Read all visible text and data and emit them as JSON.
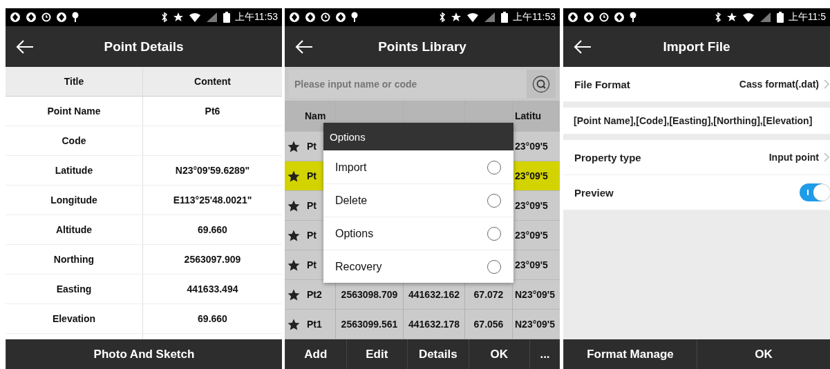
{
  "screens": [
    {
      "kind": "details",
      "status_bar": {
        "time": "上午11:53"
      },
      "title": "Point Details",
      "table": {
        "columns": [
          "Title",
          "Content"
        ],
        "rows": [
          [
            "Point Name",
            "Pt6"
          ],
          [
            "Code",
            ""
          ],
          [
            "Latitude",
            "N23°09'59.6289\""
          ],
          [
            "Longitude",
            "E113°25'48.0021\""
          ],
          [
            "Altitude",
            "69.660"
          ],
          [
            "Northing",
            "2563097.909"
          ],
          [
            "Easting",
            "441633.494"
          ],
          [
            "Elevation",
            "69.660"
          ]
        ]
      },
      "bottom_buttons": [
        "Photo And Sketch"
      ]
    },
    {
      "kind": "library",
      "status_bar": {
        "time": "上午11:53"
      },
      "title": "Points Library",
      "search": {
        "placeholder": "Please input name or code"
      },
      "table": {
        "columns": [
          "Nam",
          null,
          null,
          null,
          "Latitu"
        ],
        "rows": [
          {
            "selected": false,
            "cells": [
              "Pt",
              null,
              null,
              null,
              "23°09'5"
            ]
          },
          {
            "selected": true,
            "cells": [
              "Pt",
              null,
              null,
              null,
              "23°09'5"
            ]
          },
          {
            "selected": false,
            "cells": [
              "Pt",
              null,
              null,
              null,
              "23°09'5"
            ]
          },
          {
            "selected": false,
            "cells": [
              "Pt",
              null,
              null,
              null,
              "23°09'5"
            ]
          },
          {
            "selected": false,
            "cells": [
              "Pt",
              null,
              null,
              null,
              "23°09'5"
            ]
          },
          {
            "selected": false,
            "cells": [
              "Pt2",
              "2563098.709",
              "441632.162",
              "67.072",
              "N23°09'5"
            ]
          },
          {
            "selected": false,
            "cells": [
              "Pt1",
              "2563099.561",
              "441632.178",
              "67.056",
              "N23°09'5"
            ]
          }
        ]
      },
      "dialog": {
        "title": "Options",
        "items": [
          {
            "label": "Import",
            "selected": false
          },
          {
            "label": "Delete",
            "selected": false
          },
          {
            "label": "Options",
            "selected": false
          },
          {
            "label": "Recovery",
            "selected": false
          }
        ]
      },
      "bottom_buttons": [
        "Add",
        "Edit",
        "Details",
        "OK",
        "..."
      ]
    },
    {
      "kind": "import",
      "status_bar": {
        "time": "上午11:5"
      },
      "title": "Import File",
      "rows": [
        {
          "kind": "select",
          "label": "File Format",
          "value": "Cass format(.dat)"
        },
        {
          "kind": "text",
          "label": "[Point Name],[Code],[Easting],[Northing],[Elevation]"
        },
        {
          "kind": "select",
          "label": "Property type",
          "value": "Input point"
        },
        {
          "kind": "toggle",
          "label": "Preview",
          "on": true
        }
      ],
      "bottom_buttons": [
        "Format Manage",
        "OK"
      ]
    }
  ]
}
